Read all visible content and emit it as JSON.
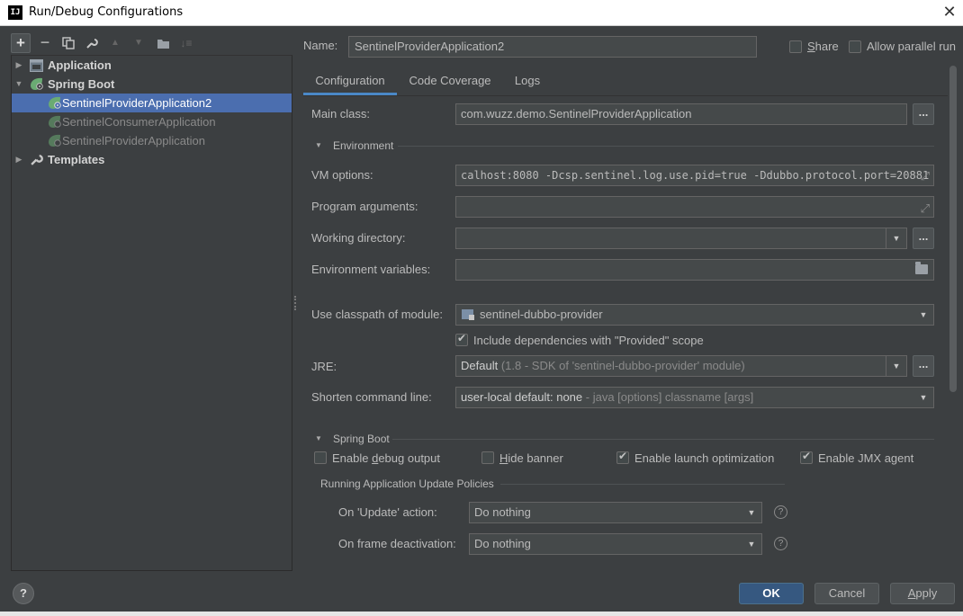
{
  "window": {
    "title": "Run/Debug Configurations",
    "app_icon": "IJ"
  },
  "tree": {
    "items": [
      {
        "label": "Application"
      },
      {
        "label": "Spring Boot"
      },
      {
        "label": "SentinelProviderApplication2"
      },
      {
        "label": "SentinelConsumerApplication"
      },
      {
        "label": "SentinelProviderApplication"
      },
      {
        "label": "Templates"
      }
    ]
  },
  "header": {
    "name_label": "Name:",
    "name_value": "SentinelProviderApplication2",
    "share_label": "Share",
    "share_checked": false,
    "parallel_label": "Allow parallel run",
    "parallel_checked": false
  },
  "tabs": [
    {
      "label": "Configuration"
    },
    {
      "label": "Code Coverage"
    },
    {
      "label": "Logs"
    }
  ],
  "config": {
    "main_class_label": "Main class:",
    "main_class_value": "com.wuzz.demo.SentinelProviderApplication",
    "environment_section": "Environment",
    "vm_options_label": "VM options:",
    "vm_options_value": "calhost:8080 -Dcsp.sentinel.log.use.pid=true -Ddubbo.protocol.port=20881",
    "program_args_label": "Program arguments:",
    "program_args_value": "",
    "working_dir_label": "Working directory:",
    "working_dir_value": "",
    "env_vars_label": "Environment variables:",
    "env_vars_value": "",
    "classpath_label": "Use classpath of module:",
    "classpath_value": "sentinel-dubbo-provider",
    "include_deps_label": "Include dependencies with \"Provided\" scope",
    "include_deps_checked": true,
    "jre_label": "JRE:",
    "jre_value": "Default",
    "jre_detail": " (1.8 - SDK of 'sentinel-dubbo-provider' module)",
    "shorten_label": "Shorten command line:",
    "shorten_value": "user-local default: none",
    "shorten_detail": " - java [options] classname [args]"
  },
  "spring_boot": {
    "section": "Spring Boot",
    "debug_output_label": "Enable debug output",
    "debug_output_checked": false,
    "hide_banner_label": "Hide banner",
    "hide_banner_checked": false,
    "launch_opt_label": "Enable launch optimization",
    "launch_opt_checked": true,
    "jmx_label": "Enable JMX agent",
    "jmx_checked": true,
    "policies_section": "Running Application Update Policies",
    "update_action_label": "On 'Update' action:",
    "update_action_value": "Do nothing",
    "frame_deactivation_label": "On frame deactivation:",
    "frame_deactivation_value": "Do nothing"
  },
  "buttons": {
    "ok": "OK",
    "cancel": "Cancel",
    "apply": "Apply",
    "help": "?",
    "browse": "..."
  },
  "colors": {
    "accent": "#4b6eaf",
    "primary_button": "#365880",
    "background": "#3c3f41",
    "spring_green": "#6aab73"
  }
}
